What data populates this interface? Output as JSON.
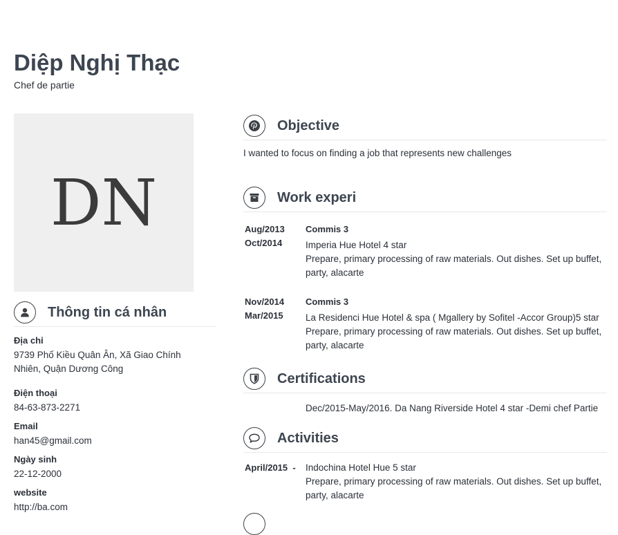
{
  "profile": {
    "name": "Diệp Nghị Thạc",
    "title": "Chef de partie",
    "avatar_initials": "DN"
  },
  "personal": {
    "heading": "Thông tin cá nhân",
    "icon": "user-icon",
    "fields": [
      {
        "label": "Địa chỉ",
        "value": "9739 Phố Kiều Quân Ân, Xã Giao Chính Nhiên, Quận Dương Công"
      },
      {
        "label": "Điện thoại",
        "value": "84-63-873-2271"
      },
      {
        "label": "Email",
        "value": "han45@gmail.com"
      },
      {
        "label": "Ngày sinh",
        "value": "22-12-2000"
      },
      {
        "label": "website",
        "value": "http://ba.com"
      }
    ]
  },
  "objective": {
    "heading": "Objective",
    "icon": "pinterest-icon",
    "text": "I wanted to focus on finding a job that represents new challenges"
  },
  "work": {
    "heading": "Work experi",
    "icon": "archive-box-icon",
    "items": [
      {
        "date_from": "Aug/2013",
        "date_to": "Oct/2014",
        "role": "Commis 3",
        "company": "Imperia Hue Hotel 4 star",
        "description": "Prepare, primary processing of raw materials. Out dishes. Set up buffet, party, alacarte"
      },
      {
        "date_from": "Nov/2014",
        "date_to": "Mar/2015",
        "role": "Commis 3",
        "company": "La Residenci Hue Hotel & spa ( Mgallery by Sofitel -Accor Group)5 star",
        "description": "Prepare, primary processing of raw materials. Out dishes. Set up buffet, party, alacarte"
      }
    ]
  },
  "certifications": {
    "heading": "Certifications",
    "icon": "shield-icon",
    "text": "Dec/2015-May/2016.  Da Nang Riverside Hotel 4 star -Demi chef Partie"
  },
  "activities": {
    "heading": "Activities",
    "icon": "speech-bubble-icon",
    "items": [
      {
        "date": "April/2015  -",
        "company": "Indochina Hotel Hue 5 star",
        "description": "Prepare, primary processing of raw materials. Out dishes. Set up buffet, party, alacarte"
      }
    ]
  },
  "colors": {
    "heading": "#3d4550",
    "text": "#2b3038",
    "avatar_bg": "#efefef",
    "divider": "#e8e8e8"
  }
}
